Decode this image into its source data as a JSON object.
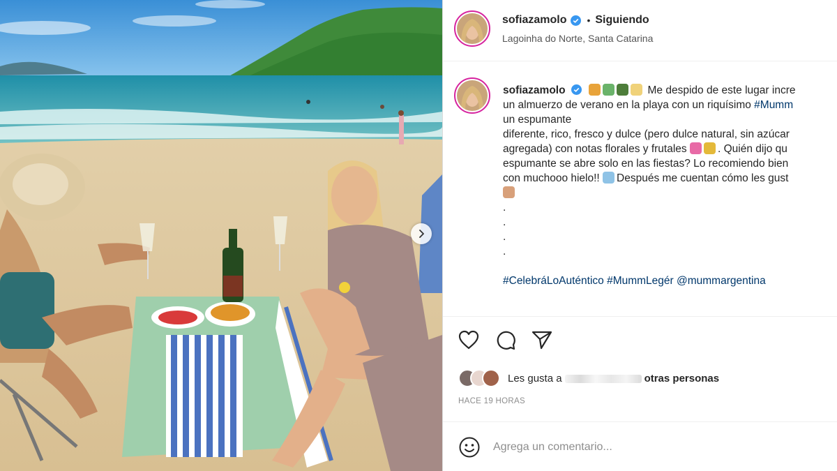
{
  "post": {
    "username": "sofiazamolo",
    "follow_status": "Siguiendo",
    "separator": "•",
    "location": "Lagoinha do Norte, Santa Catarina"
  },
  "caption": {
    "username": "sofiazamolo",
    "line1_text": "Me despido de este lugar incre",
    "line2_text": "un almuerzo de verano en la playa con un riquísimo ",
    "line2_hashtag": "#Mumm",
    "line3": "un espumante",
    "line4": "diferente, rico, fresco y dulce (pero dulce natural, sin azúcar",
    "line5": "agregada) con notas florales y frutales ",
    "line5_end": ". Quién dijo qu",
    "line6": "espumante se abre solo en las fiestas? Lo recomiendo bien",
    "line7_start": "con muchooo hielo!! ",
    "line7_end": "Después me cuentan cómo les gust",
    "dots": [
      ".",
      ".",
      ".",
      "."
    ],
    "hashtags": "#CelebráLoAuténtico #MummLegér @mummargentina"
  },
  "likes": {
    "prefix": "Les gusta a",
    "suffix": "otras personas"
  },
  "timestamp": "HACE 19 HORAS",
  "comment": {
    "placeholder": "Agrega un comentario..."
  },
  "colors": {
    "verified": "#3897f0",
    "hashtag": "#00376b",
    "ring": "#d6249f",
    "muted": "#8e8e8e"
  },
  "icons": [
    "verified-icon",
    "heart-icon",
    "comment-icon",
    "share-icon",
    "emoji-icon",
    "chevron-right-icon"
  ]
}
